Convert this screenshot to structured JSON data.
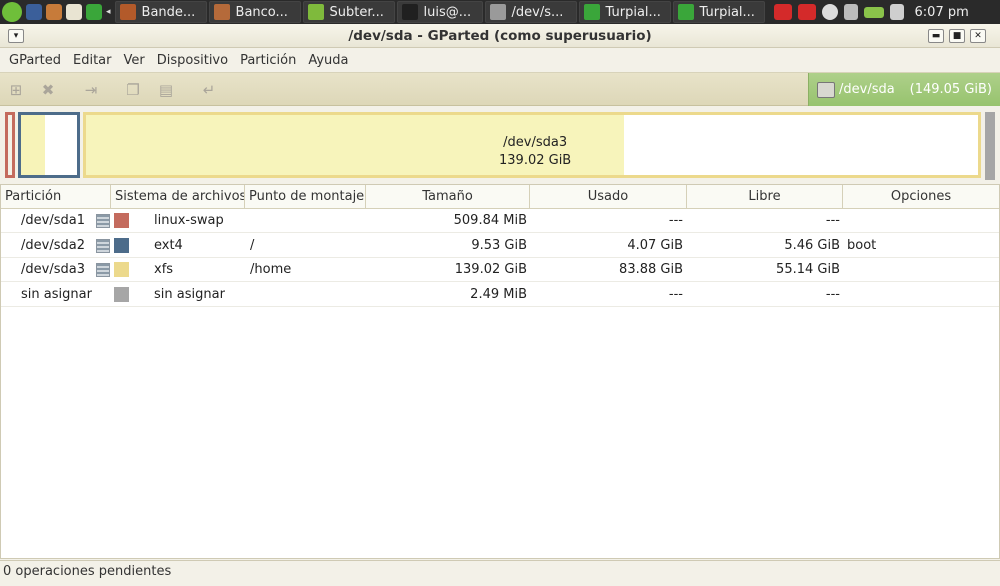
{
  "panel": {
    "tasks": [
      {
        "label": "Bande...",
        "icon_color": "#b35a2a"
      },
      {
        "label": "Banco...",
        "icon_color": "#b56a3a"
      },
      {
        "label": "Subter...",
        "icon_color": "#7fba3c"
      },
      {
        "label": "luis@...",
        "icon_color": "#202020"
      },
      {
        "label": "/dev/s...",
        "icon_color": "#9a9a9a"
      },
      {
        "label": "Turpial...",
        "icon_color": "#3aa63a"
      },
      {
        "label": "Turpial...",
        "icon_color": "#3aa63a"
      }
    ],
    "clock": "6:07 pm"
  },
  "window": {
    "title": "/dev/sda - GParted (como superusuario)"
  },
  "menubar": {
    "items": [
      "GParted",
      "Editar",
      "Ver",
      "Dispositivo",
      "Partición",
      "Ayuda"
    ]
  },
  "toolbar": {
    "device": {
      "name": "/dev/sda",
      "size": "(149.05 GiB)"
    }
  },
  "graph": {
    "selected": {
      "name": "/dev/sda3",
      "size": "139.02 GiB"
    }
  },
  "table": {
    "headers": {
      "particion": "Partición",
      "sistema": "Sistema de archivos",
      "montaje": "Punto de montaje",
      "tamano": "Tamaño",
      "usado": "Usado",
      "libre": "Libre",
      "opciones": "Opciones"
    },
    "rows": [
      {
        "particion": "/dev/sda1",
        "sistema": "linux-swap",
        "montaje": "",
        "tamano": "509.84 MiB",
        "usado": "---",
        "libre": "---",
        "opciones": "",
        "color": "#c46b5e"
      },
      {
        "particion": "/dev/sda2",
        "sistema": "ext4",
        "montaje": "/",
        "tamano": "9.53 GiB",
        "usado": "4.07 GiB",
        "libre": "5.46 GiB",
        "opciones": "boot",
        "color": "#4d6c8a"
      },
      {
        "particion": "/dev/sda3",
        "sistema": "xfs",
        "montaje": "/home",
        "tamano": "139.02 GiB",
        "usado": "83.88 GiB",
        "libre": "55.14 GiB",
        "opciones": "",
        "color": "#ecd98c"
      },
      {
        "particion": "sin asignar",
        "sistema": "sin asignar",
        "montaje": "",
        "tamano": "2.49 MiB",
        "usado": "---",
        "libre": "---",
        "opciones": "",
        "color": "#a6a6a6"
      }
    ]
  },
  "status": {
    "text": "0 operaciones pendientes"
  }
}
